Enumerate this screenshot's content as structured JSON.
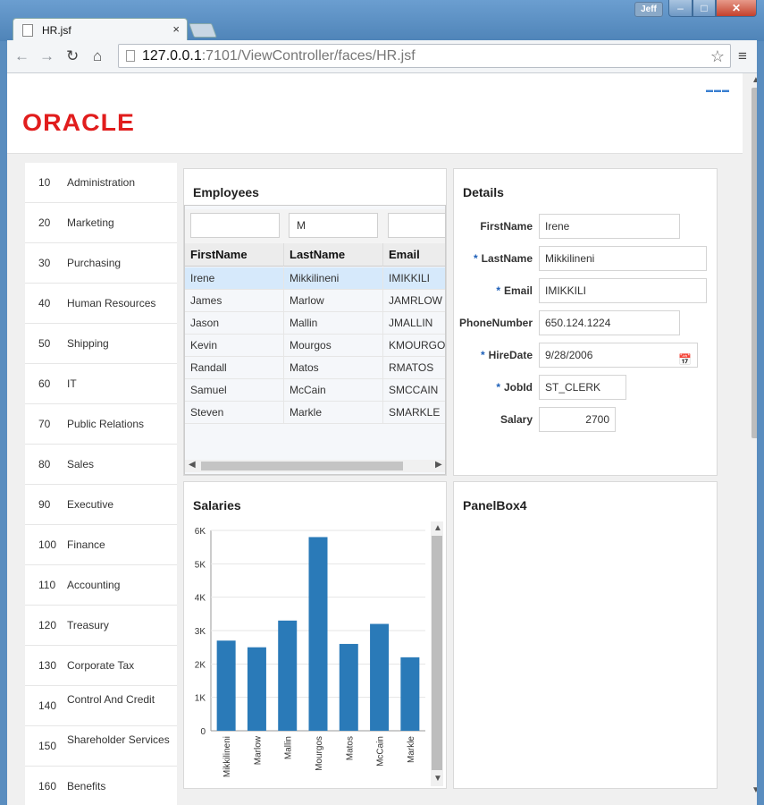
{
  "browser": {
    "tab_title": "HR.jsf",
    "tab_close": "×",
    "user": "Jeff",
    "url_host": "127.0.0.1",
    "url_path": ":7101/ViewController/faces/HR.jsf"
  },
  "app": {
    "logo": "ORACLE"
  },
  "departments": [
    {
      "id": "10",
      "name": "Administration"
    },
    {
      "id": "20",
      "name": "Marketing"
    },
    {
      "id": "30",
      "name": "Purchasing"
    },
    {
      "id": "40",
      "name": "Human Resources"
    },
    {
      "id": "50",
      "name": "Shipping"
    },
    {
      "id": "60",
      "name": "IT"
    },
    {
      "id": "70",
      "name": "Public Relations"
    },
    {
      "id": "80",
      "name": "Sales"
    },
    {
      "id": "90",
      "name": "Executive"
    },
    {
      "id": "100",
      "name": "Finance"
    },
    {
      "id": "110",
      "name": "Accounting"
    },
    {
      "id": "120",
      "name": "Treasury"
    },
    {
      "id": "130",
      "name": "Corporate Tax"
    },
    {
      "id": "140",
      "name": "Control And Credit"
    },
    {
      "id": "150",
      "name": "Shareholder Services"
    },
    {
      "id": "160",
      "name": "Benefits"
    }
  ],
  "employees": {
    "title": "Employees",
    "filters": [
      "",
      "M",
      ""
    ],
    "columns": [
      "FirstName",
      "LastName",
      "Email"
    ],
    "rows": [
      [
        "Irene",
        "Mikkilineni",
        "IMIKKILI"
      ],
      [
        "James",
        "Marlow",
        "JAMRLOW"
      ],
      [
        "Jason",
        "Mallin",
        "JMALLIN"
      ],
      [
        "Kevin",
        "Mourgos",
        "KMOURGOS"
      ],
      [
        "Randall",
        "Matos",
        "RMATOS"
      ],
      [
        "Samuel",
        "McCain",
        "SMCCAIN"
      ],
      [
        "Steven",
        "Markle",
        "SMARKLE"
      ]
    ],
    "selected_row": 0
  },
  "details": {
    "title": "Details",
    "fields": [
      {
        "label": "FirstName",
        "value": "Irene",
        "required": false
      },
      {
        "label": "LastName",
        "value": "Mikkilineni",
        "required": true
      },
      {
        "label": "Email",
        "value": "IMIKKILI",
        "required": true
      },
      {
        "label": "PhoneNumber",
        "value": "650.124.1224",
        "required": false
      },
      {
        "label": "HireDate",
        "value": "9/28/2006",
        "required": true
      },
      {
        "label": "JobId",
        "value": "ST_CLERK",
        "required": true
      },
      {
        "label": "Salary",
        "value": "2700",
        "required": false
      }
    ],
    "required_marker": "*"
  },
  "panel4": {
    "title": "PanelBox4"
  },
  "chart_data": {
    "type": "bar",
    "title": "Salaries",
    "categories": [
      "Mikkilineni",
      "Marlow",
      "Mallin",
      "Mourgos",
      "Matos",
      "McCain",
      "Markle"
    ],
    "values": [
      2700,
      2500,
      3300,
      5800,
      2600,
      3200,
      2200
    ],
    "yticks": [
      "0",
      "1K",
      "2K",
      "3K",
      "4K",
      "5K",
      "6K"
    ],
    "ylim": [
      0,
      6000
    ],
    "color": "#2a7ab8",
    "grid": true
  }
}
